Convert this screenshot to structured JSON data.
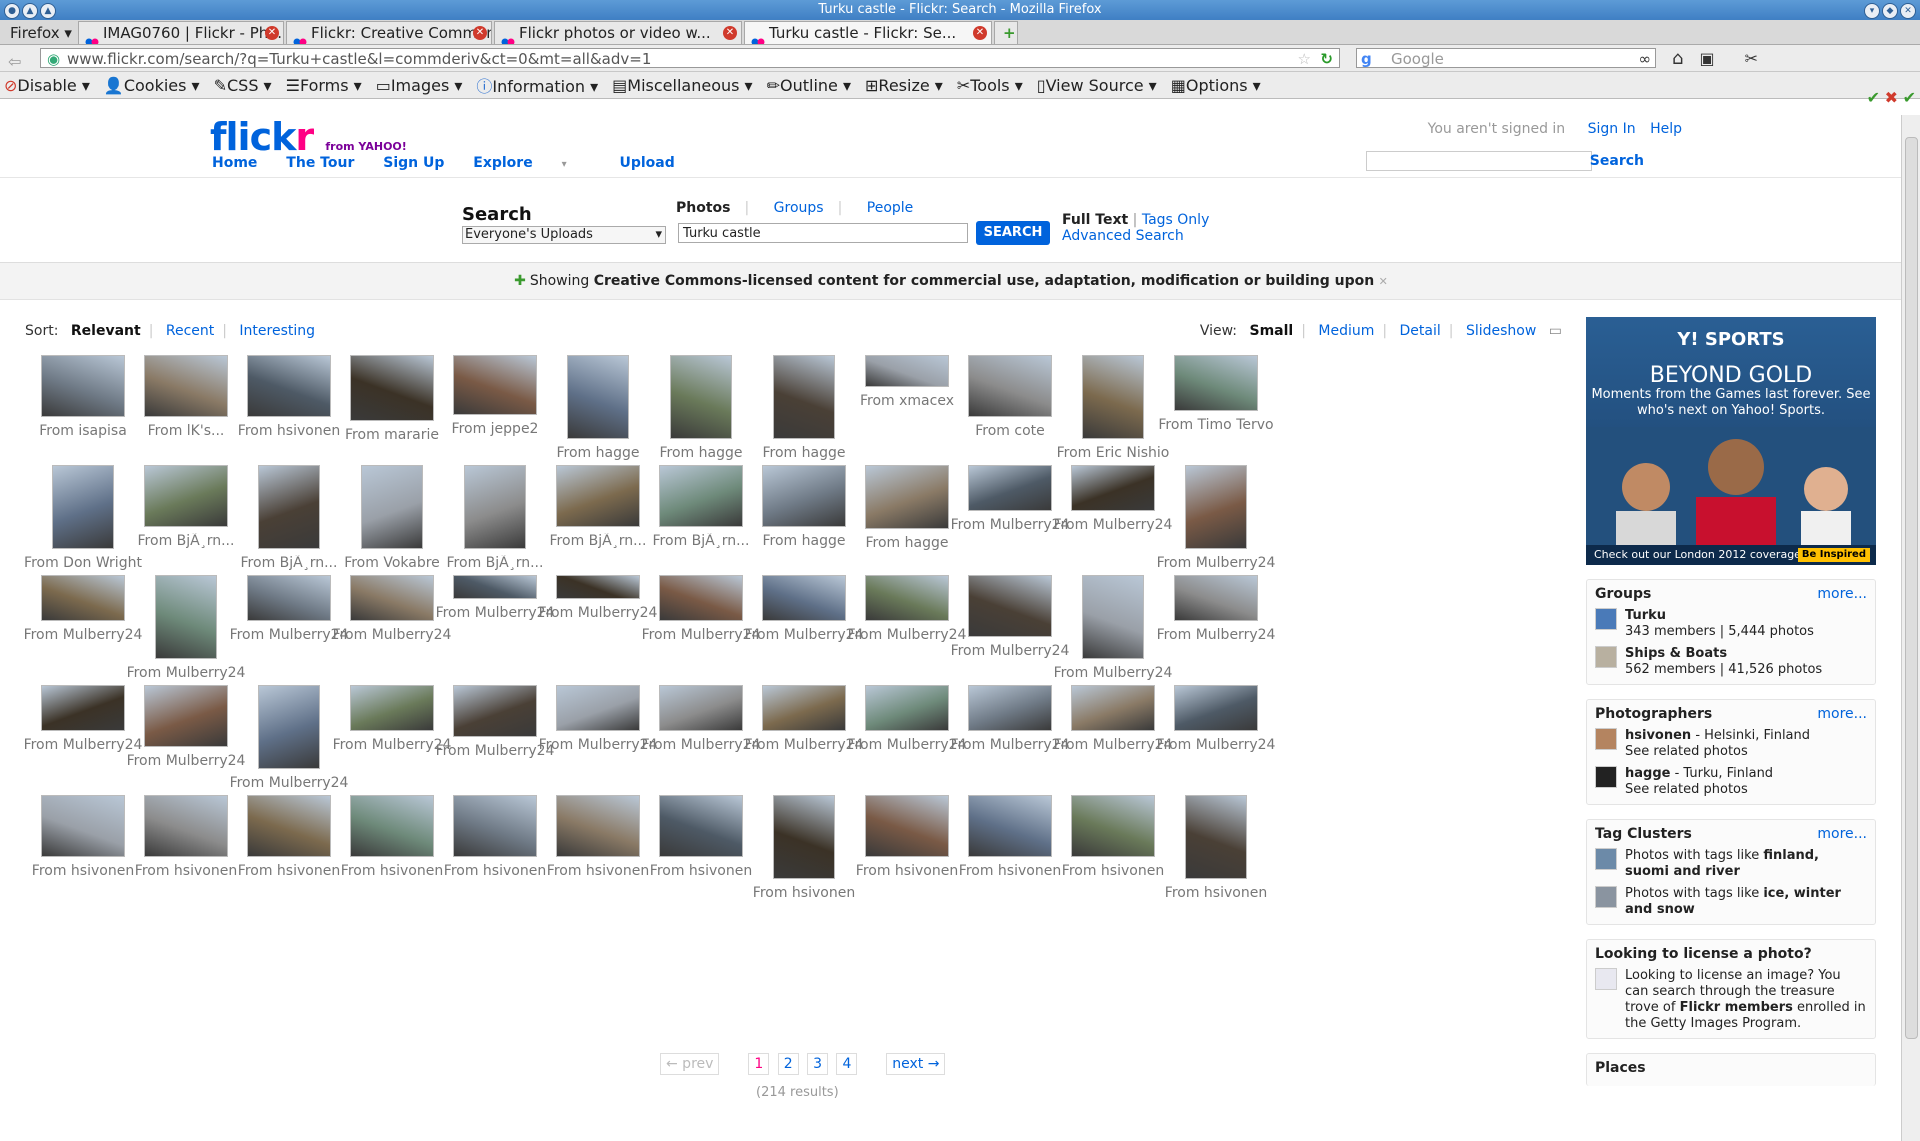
{
  "window": {
    "title": "Turku castle - Flickr: Search - Mozilla Firefox"
  },
  "browser": {
    "menu_label": "Firefox",
    "tabs": [
      {
        "label": "IMAG0760 | Flickr - Pho..."
      },
      {
        "label": "Flickr: Creative Commons"
      },
      {
        "label": "Flickr photos or video w..."
      },
      {
        "label": "Turku castle - Flickr: Se..."
      }
    ],
    "new_tab_label": "+",
    "url": "www.flickr.com/search/?q=Turku+castle&l=commderiv&ct=0&mt=all&adv=1",
    "search_placeholder": "Google"
  },
  "devtoolbar": {
    "items": [
      "Disable",
      "Cookies",
      "CSS",
      "Forms",
      "Images",
      "Information",
      "Miscellaneous",
      "Outline",
      "Resize",
      "Tools",
      "View Source",
      "Options"
    ]
  },
  "header": {
    "logo_main": "flick",
    "logo_r": "r",
    "logo_yahoo": "from YAHOO!",
    "nav": [
      "Home",
      "The Tour",
      "Sign Up",
      "Explore",
      "Upload"
    ],
    "not_signed": "You aren't signed in",
    "sign_in": "Sign In",
    "help": "Help",
    "search_button": "Search"
  },
  "search": {
    "title": "Search",
    "scope": "Everyone's Uploads",
    "tabs": [
      "Photos",
      "Groups",
      "People"
    ],
    "query": "Turku castle",
    "button": "SEARCH",
    "full_text": "Full Text",
    "tags_only": "Tags Only",
    "advanced": "Advanced Search"
  },
  "ccbar": {
    "prefix": "Showing",
    "bold": "Creative Commons-licensed content for commercial use, adaptation, modification or building upon"
  },
  "sort": {
    "label": "Sort:",
    "options": [
      "Relevant",
      "Recent",
      "Interesting"
    ]
  },
  "view": {
    "label": "View:",
    "options": [
      "Small",
      "Medium",
      "Detail",
      "Slideshow"
    ]
  },
  "rows": [
    [
      "From isapisa",
      "From lK's...",
      "From hsivonen",
      "From mararie",
      "From jeppe2",
      "From hagge",
      "From hagge",
      "From hagge",
      "From xmacex",
      "From cote",
      "From Eric Nishio",
      "From Timo Tervo"
    ],
    [
      "From Don Wright",
      "From BjÃ¸rn...",
      "From BjÃ¸rn...",
      "From Vokabre",
      "From BjÃ¸rn...",
      "From BjÃ¸rn...",
      "From BjÃ¸rn...",
      "From hagge",
      "From hagge",
      "From Mulberry24",
      "From Mulberry24",
      "From Mulberry24"
    ],
    [
      "From Mulberry24",
      "From Mulberry24",
      "From Mulberry24",
      "From Mulberry24",
      "From Mulberry24",
      "From Mulberry24",
      "From Mulberry24",
      "From Mulberry24",
      "From Mulberry24",
      "From Mulberry24",
      "From Mulberry24",
      "From Mulberry24"
    ],
    [
      "From Mulberry24",
      "From Mulberry24",
      "From Mulberry24",
      "From Mulberry24",
      "From Mulberry24",
      "From Mulberry24",
      "From Mulberry24",
      "From Mulberry24",
      "From Mulberry24",
      "From Mulberry24",
      "From Mulberry24",
      "From Mulberry24"
    ],
    [
      "From hsivonen",
      "From hsivonen",
      "From hsivonen",
      "From hsivonen",
      "From hsivonen",
      "From hsivonen",
      "From hsivonen",
      "From hsivonen",
      "From hsivonen",
      "From hsivonen",
      "From hsivonen",
      "From hsivonen"
    ]
  ],
  "pager": {
    "prev": "← prev",
    "pages": [
      "1",
      "2",
      "3",
      "4"
    ],
    "next": "next →",
    "results": "(214 results)"
  },
  "ad": {
    "brand": "Y! SPORTS",
    "headline": "BEYOND GOLD",
    "tagline": "Moments from the Games last forever. See who's next on Yahoo! Sports.",
    "bottom": "Check out our London 2012 coverage",
    "cta": "Be Inspired"
  },
  "groups": {
    "title": "Groups",
    "more": "more...",
    "items": [
      {
        "name": "Turku",
        "meta": "343 members | 5,444 photos"
      },
      {
        "name": "Ships & Boats",
        "meta": "562 members | 41,526 photos"
      }
    ]
  },
  "photographers": {
    "title": "Photographers",
    "more": "more...",
    "items": [
      {
        "name": "hsivonen",
        "loc": " - Helsinki, Finland",
        "meta": "See related photos"
      },
      {
        "name": "hagge",
        "loc": " - Turku, Finland",
        "meta": "See related photos"
      }
    ]
  },
  "tagclusters": {
    "title": "Tag Clusters",
    "more": "more...",
    "items": [
      {
        "pre": "Photos with tags like ",
        "tags": "finland, suomi and river"
      },
      {
        "pre": "Photos with tags like ",
        "tags": "ice, winter and snow"
      }
    ]
  },
  "license": {
    "title": "Looking to license a photo?",
    "text1": "Looking to license an image? You can search through the treasure trove of ",
    "bold": "Flickr members",
    "text2": " enrolled in the Getty Images Program."
  },
  "places": {
    "title": "Places"
  }
}
